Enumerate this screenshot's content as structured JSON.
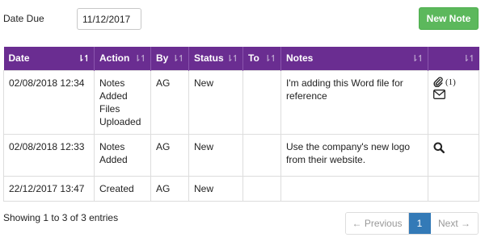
{
  "filter": {
    "date_due_label": "Date Due",
    "date_due_value": "11/12/2017"
  },
  "toolbar": {
    "new_note_label": "New Note",
    "new_note_color": "#5cb85c"
  },
  "table": {
    "header_color": "#6a2d91",
    "columns": [
      "Date",
      "Action",
      "By",
      "Status",
      "To",
      "Notes",
      ""
    ],
    "rows": [
      {
        "date": "02/08/2018 12:34",
        "action": "Notes Added Files Uploaded",
        "by": "AG",
        "status": "New",
        "to": "",
        "notes": "I'm adding this Word file for reference",
        "attachment_count": "(1)",
        "icons": [
          "paperclip-icon",
          "envelope-icon"
        ]
      },
      {
        "date": "02/08/2018 12:33",
        "action": "Notes Added",
        "by": "AG",
        "status": "New",
        "to": "",
        "notes": "Use the company's new logo from their website.",
        "icons": [
          "search-icon"
        ]
      },
      {
        "date": "22/12/2017 13:47",
        "action": "Created",
        "by": "AG",
        "status": "New",
        "to": "",
        "notes": "",
        "icons": []
      }
    ]
  },
  "footer": {
    "info": "Showing 1 to 3 of 3 entries",
    "previous_label": "← Previous",
    "current_page": "1",
    "next_label": "Next →",
    "active_page_color": "#337ab7"
  }
}
